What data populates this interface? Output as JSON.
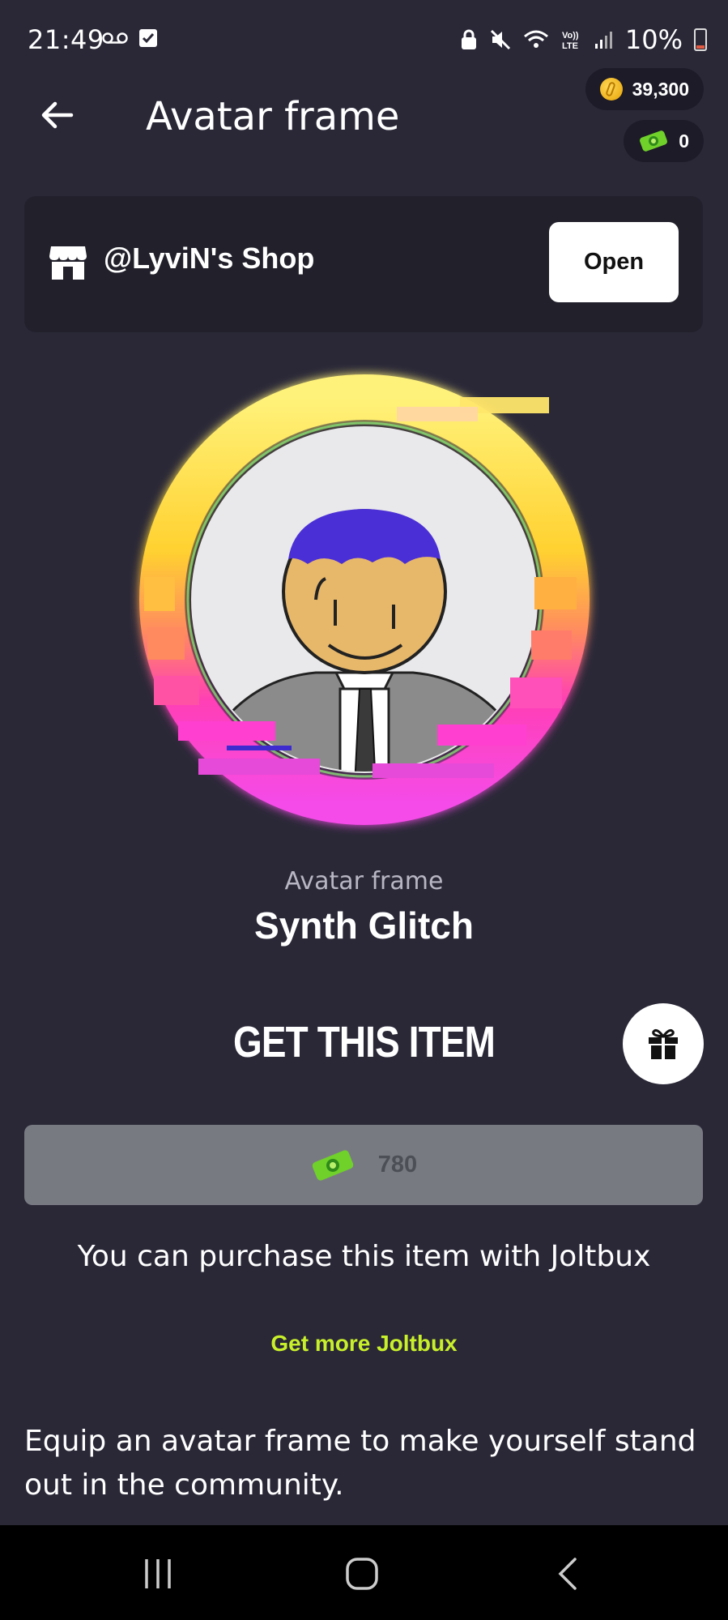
{
  "status_bar": {
    "time": "21:49",
    "battery": "10%",
    "icons": [
      "voicemail-icon",
      "checkbox-icon",
      "lock-icon",
      "mute-icon",
      "wifi-icon",
      "volte-icon",
      "signal-icon",
      "battery-icon"
    ]
  },
  "header": {
    "title": "Avatar frame",
    "back_icon": "arrow-left-icon",
    "coins": "39,300",
    "joltbux": "0"
  },
  "shop": {
    "name": "@LyviN's Shop",
    "open_label": "Open",
    "icon": "store-icon"
  },
  "item": {
    "type": "Avatar frame",
    "name": "Synth Glitch"
  },
  "purchase": {
    "heading": "GET THIS ITEM",
    "price": "780",
    "note": "You can purchase this item with Joltbux",
    "get_more": "Get more Joltbux",
    "gift_icon": "gift-icon"
  },
  "description": "Equip an avatar frame to make yourself stand out in the community.",
  "colors": {
    "background": "#2a2837",
    "card": "#21202b",
    "accent_link": "#c8f02a",
    "price_button": "#787a82"
  }
}
